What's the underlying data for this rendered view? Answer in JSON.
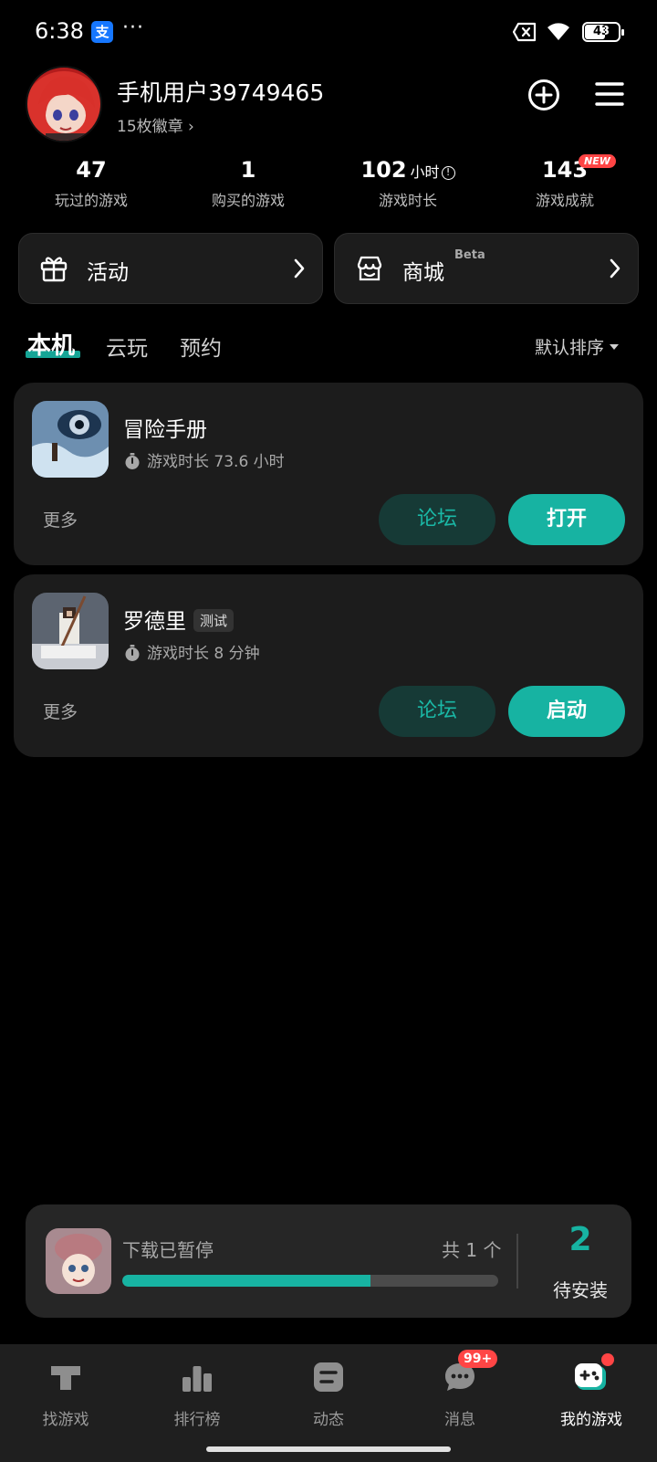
{
  "status_bar": {
    "time": "6:38",
    "alipay_glyph": "支",
    "more_dots": "···",
    "battery": "43"
  },
  "profile": {
    "username": "手机用户39749465",
    "badges": "15枚徽章 ›"
  },
  "stats": [
    {
      "value": "47",
      "unit": "",
      "label": "玩过的游戏"
    },
    {
      "value": "1",
      "unit": "",
      "label": "购买的游戏"
    },
    {
      "value": "102",
      "unit": "小时",
      "label": "游戏时长"
    },
    {
      "value": "143",
      "unit": "",
      "label": "游戏成就",
      "badge": "NEW"
    }
  ],
  "quick_links": {
    "activity": "活动",
    "store": "商城",
    "store_tag": "Beta"
  },
  "tabs": [
    "本机",
    "云玩",
    "预约"
  ],
  "sort_label": "默认排序",
  "games": [
    {
      "name": "冒险手册",
      "tag": "",
      "playtime": "游戏时长 73.6 小时",
      "more": "更多",
      "forum": "论坛",
      "action": "打开"
    },
    {
      "name": "罗德里",
      "tag": "测试",
      "playtime": "游戏时长 8 分钟",
      "more": "更多",
      "forum": "论坛",
      "action": "启动"
    }
  ],
  "download": {
    "status": "下载已暂停",
    "count": "共 1 个",
    "progress": 0.66,
    "pending_count": "2",
    "pending_label": "待安装"
  },
  "bottom_nav": [
    {
      "label": "找游戏"
    },
    {
      "label": "排行榜"
    },
    {
      "label": "动态"
    },
    {
      "label": "消息",
      "badge": "99+"
    },
    {
      "label": "我的游戏",
      "active": true
    }
  ],
  "colors": {
    "accent": "#17b3a2",
    "card_bg": "#1c1c1c",
    "badge_red": "#ff4545"
  }
}
